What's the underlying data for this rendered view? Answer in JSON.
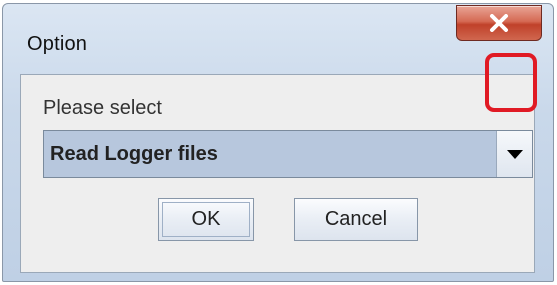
{
  "dialog": {
    "title": "Option",
    "prompt": "Please select",
    "combo": {
      "selected": "Read Logger files"
    },
    "buttons": {
      "ok": "OK",
      "cancel": "Cancel"
    }
  },
  "icons": {
    "close": "close-icon",
    "dropdown": "chevron-down-icon"
  },
  "colors": {
    "close_button": "#c9503a",
    "combo_background": "#b7c7dd",
    "highlight": "#e01a24"
  }
}
